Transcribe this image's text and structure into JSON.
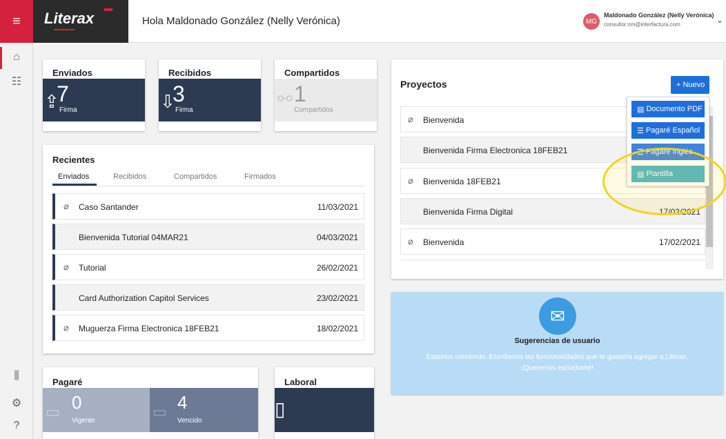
{
  "header": {
    "logo": "Literax",
    "greeting": "Hola Maldonado González (Nelly Verónica)",
    "avatar_initials": "MG",
    "user_name": "Maldonado González (Nelly Verónica)",
    "user_email": "consultor.nm@interfactura.com"
  },
  "stats": [
    {
      "title": "Enviados",
      "value": "7",
      "label": "Firma"
    },
    {
      "title": "Recibidos",
      "value": "3",
      "label": "Firma"
    },
    {
      "title": "Compartidos",
      "value": "1",
      "label": "Compartidos"
    }
  ],
  "recientes": {
    "title": "Recientes",
    "tabs": [
      "Enviados",
      "Recibidos",
      "Compartidos",
      "Firmados"
    ],
    "rows": [
      {
        "name": "Caso Santander",
        "date": "11/03/2021"
      },
      {
        "name": "Bienvenida Tutorial 04MAR21",
        "date": "04/03/2021"
      },
      {
        "name": "Tutorial",
        "date": "26/02/2021"
      },
      {
        "name": "Card Authorization Capitol Services",
        "date": "23/02/2021"
      },
      {
        "name": "Muguerza Firma Electronica 18FEB21",
        "date": "18/02/2021"
      }
    ]
  },
  "proyectos": {
    "title": "Proyectos",
    "new_button": "+ Nuevo",
    "rows": [
      {
        "name": "Bienvenida",
        "date": ""
      },
      {
        "name": "Bienvenida Firma Electronica 18FEB21",
        "date": ""
      },
      {
        "name": "Bienvenida 18FEB21",
        "date": ""
      },
      {
        "name": "Bienvenida Firma Digital",
        "date": "17/02/2021"
      },
      {
        "name": "Bienvenida",
        "date": "17/02/2021"
      }
    ],
    "menu": [
      "Documento PDF",
      "Pagaré Español",
      "Pagaré Inglés",
      "Plantilla"
    ]
  },
  "sugerencias": {
    "title": "Sugerencias de usuario",
    "text1": "Estamos creciendo. Escríbenos las funcionalidades que te gustaría agregar a Literax.",
    "text2": "¡Queremos escucharte!"
  },
  "pagare": {
    "title": "Pagaré",
    "vigente_value": "0",
    "vigente_label": "Vigente",
    "vencido_value": "4",
    "vencido_label": "Vencido"
  },
  "laboral": {
    "title": "Laboral"
  },
  "colors": {
    "brand_red": "#d4213d",
    "navy": "#2c3a52",
    "blue": "#1e6fd9",
    "teal": "#4db6c8",
    "highlight": "#f5d31a"
  }
}
